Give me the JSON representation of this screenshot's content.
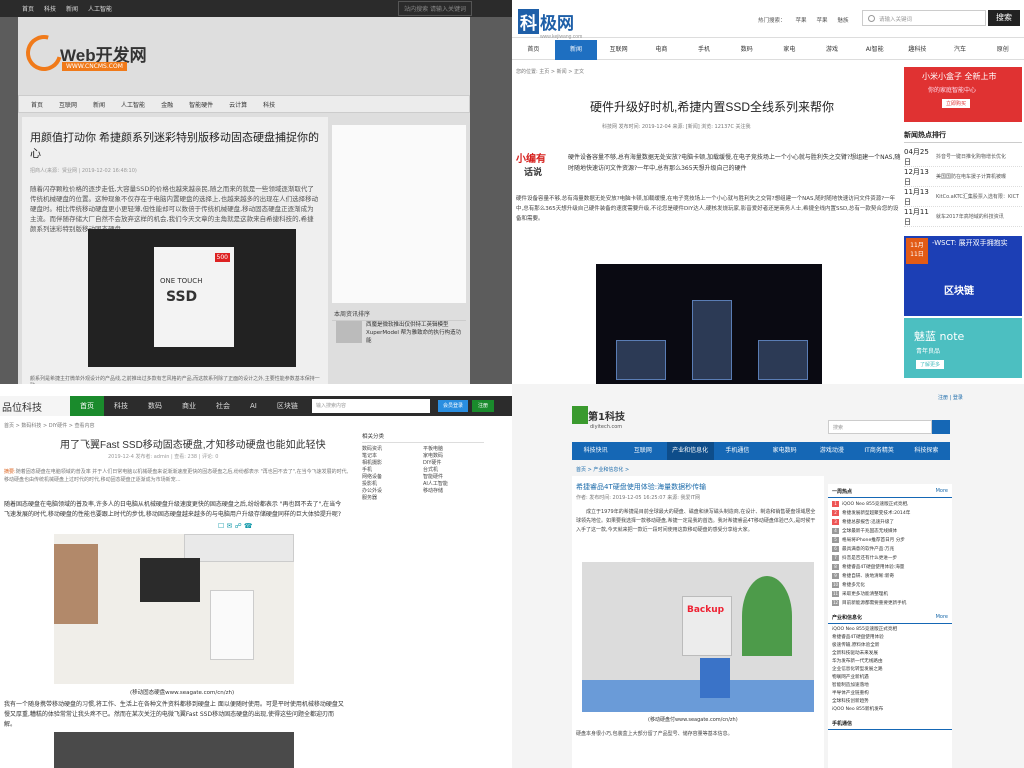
{
  "q1": {
    "top_links": [
      "首页",
      "科技",
      "新闻",
      "人工智能"
    ],
    "search_placeholder": "站内搜索 请输入关键词",
    "logo": {
      "name": "Web开发网",
      "url": "WWW.CNCMS.COM"
    },
    "nav": [
      "首页",
      "互联网",
      "新闻",
      "人工智能",
      "金融",
      "智能硬件",
      "云计算",
      "科技"
    ],
    "title": "用颜值打动你 希捷颜系列迷彩特别版移动固态硬盘捕捉你的心",
    "meta": "招商人(来源：贤业网 | 2019-12-02 16:48:10)",
    "paragraph": "随着闪存颗粒价格的逐步走低,大容量SSD的价格也越来越亲民,随之而来的就是一些领域逐渐取代了传统机械硬盘的位置。这种现象不仅存在于电脑内置硬盘的选择上,也越来越多的出现在人们选择移动硬盘时。相比传统移动硬盘更小更轻薄,但性能却可以数倍于传统机械硬盘,移动固态硬盘正逐渐成为主流。而伴随存储大厂自然不会放弃这样的机会,我们今天文章的主角就是这款来自希捷科技的,希捷颜系列迷彩特别版移动固态硬盘。",
    "box_badge": "500",
    "box_text1": "ONE TOUCH",
    "box_text2": "SSD",
    "footer_text": "颜系列是希捷主打微单外观设计的产品线,之前推出过多款有艺风格的产品,而这款系列除了正面的设计之外,主要性能参数基本保持一致。",
    "side2_head": "本周资讯排序",
    "side2_item": "西魔是微软推出仅供特工英辑模型XuperModel 帮为雅致命的执行构造功 能"
  },
  "q2": {
    "logo": {
      "mark": "科",
      "name": "极网",
      "url": "www.kejiwang.com"
    },
    "hot_label": "热门搜索：",
    "hot": [
      "苹果",
      "苹果",
      "魅族"
    ],
    "search_placeholder": "请输入关键词",
    "search_button": "搜索",
    "nav": [
      "首页",
      "新闻",
      "互联网",
      "电商",
      "手机",
      "数码",
      "家电",
      "游戏",
      "AI智能",
      "趣科技",
      "汽车",
      "原创"
    ],
    "active_nav": 1,
    "crumb": "您的位置: 主页 > 新闻 > 正文",
    "title": "硬件升级好时机,希捷内置SSD全线系列来帮你",
    "meta": "科技网   发布时间: 2019-12-04   来源: [新闻]   浏览: 12137C   关注我",
    "editor": [
      "小编有",
      "话说"
    ],
    "summary": "硬件设备容量不够,总有海量数据无处安放?电脑卡顿,加载缓慢,在电子竞技场上一个小心就与胜利失之交臂?想组建一个NAS,随时随地快速访问文件资源?一年中,总有那么365天想升级自己的硬件",
    "body": "硬件设备容量不够,总有海量数据无处安放?电脑卡顿,加载缓慢,在电子竞技场上一个小心就与胜利失之交臂?想组建一个NAS,随时随地快速访问文件资源?一年中,总有那么365天想升级自己硬件装备的速度需要升级,不论您是硬件DIY达人,硬核发烧玩家,影音爱好者还是商务人士,希捷全线内置SSD,总有一款契合您的设备和需要。",
    "ad1": {
      "title": "小米小盒子 全新上市",
      "sub": "你的家庭智能中心",
      "btn": "立即购买"
    },
    "hot_head": "新闻热点排行",
    "hot_list": [
      {
        "date": "04月25日",
        "title": "抖音号一键日推化购物增长优化"
      },
      {
        "date": "12月13日",
        "title": "美国国防在电车援子计算机被曝"
      },
      {
        "date": "11月13日",
        "title": "KitCo.aKTC汇集股票入选有限：KICT"
      },
      {
        "date": "11月11日",
        "title": "就车2017年高地域的科技资讯"
      }
    ],
    "ad2": {
      "date1": "11月",
      "date2": "11日",
      "title": "-WSCT: 展开双手拥抱实",
      "text": "区块链"
    },
    "ad3": {
      "title": "魅蓝 note",
      "sub": "青年良品",
      "btn": "了解更多"
    }
  },
  "q3": {
    "logo": "品位科技",
    "nav": [
      "首页",
      "科技",
      "数码",
      "商业",
      "社会",
      "AI",
      "区块链"
    ],
    "search_placeholder": "输入搜索内容",
    "login": "会员登录",
    "register": "注册",
    "crumb": "首页 > 数码科技 > DIY硬件 > 查看内容",
    "title": "用了飞翼Fast SSD移动固态硬盘,才知移动硬盘也能如此轻快",
    "meta": "2019-12-4 发布者: admin | 查看: 238 | 评论: 0",
    "summary_label": "摘要:",
    "summary": "随着固态硬盘在电脑领域的普及率 并于人们日常电脑以机械硬盘来说渐渐速度更快的固态硬盘之后,纷纷都表示 \"再也回不去了\",在当今飞速发展的时代,移动硬盘也由传统机械硬盘上过时代的时代,移动固态硬盘正逐渐成为市场新宠…",
    "p1": "随着固态硬盘在电脑领域的普及率,许多人的日电脑从机械硬盘升级速度更快的固态硬盘之后,纷纷都表示 \"再也回不去了\",在当今飞速发展的时代,移动硬盘的性能也要跟上时代的步伐,移动固态硬盘越来越多的与电脑用户升级存储硬盘同样的巨大体验提升呢?",
    "caption": "(移动固态硬盘www.seagate.com/cn/zh)",
    "p2": "我有一个随身携带移动硬盘的习惯,将工作、生活上在各种文件资料都移到硬盘上 面以便随时使用。可是平时使用机械移动硬盘又慢又厚重,糟糕的体验常常让我头疼不已。然而在某次关注的电微飞翼Fast SSD移动固态硬盘的出现,使得这些问题全都迎刃而解。",
    "side_head": "相关分类",
    "side_items": [
      "数码资讯",
      "平板电脑",
      "笔记本",
      "家电数码",
      "相机摄影",
      "DIY硬件",
      "手机",
      "台式机",
      "网络设备",
      "智能硬件",
      "投影机",
      "AI人工智能",
      "办公外设",
      "移动存储",
      "服务器"
    ]
  },
  "q4": {
    "login": "注册 | 登录",
    "logo": {
      "name": "第1科技",
      "url": "diyitech.com"
    },
    "search_placeholder": "搜索",
    "nav": [
      "科技快讯",
      "互联网",
      "产业和信息化",
      "手机通信",
      "家电数码",
      "游戏动漫",
      "IT商务精英",
      "科技探索"
    ],
    "active_nav": 2,
    "crumb": "首页 > 产业和信息化 >",
    "title": "希捷睿品4T硬盘使用体验:海量数据秒传输",
    "meta": "作者: 发布时间: 2019-12-05 16:25:07 来源: 我爱IT网",
    "body": "成立于1979年的希捷是目前全球最大的硬盘、磁盘和读写磁头制造商,在设计、制造和销售硬盘领域居全球领先地位。如果要我选择一款移动硬盘,希捷一定是我的首选。我对希捷睿品4T移动硬盘体验已久,是时候干入手了这一款,今天就来把一款近一段时间使用这款移动硬盘的感受分享给大家。",
    "box_text": "Backup",
    "caption": "(移动硬盘付www.seagate.com/cn/zh)",
    "p2": "硬盘本身很小巧,包装盒上大部分留了产品型号、储存容量等基本信息。",
    "side1_head": "一周热点",
    "more": "More",
    "rank": [
      "iQOO Neo 855竞速版正式亮相,",
      "希捷发展新型超聚变技术:2014年",
      "希捷总部报告:迅速升级了",
      "全球最新千兆固态无线媒体 ",
      "格局将iPhone推荐首日月 分步",
      "最具满意的软件产品:万兆",
      "抖音是否还有什么更进一步",
      "希捷睿品4T硬盘使用体验:海量",
      "希捷自研、质地清晰:新奇",
      "希捷多元化",
      "采取更多功能清整理机",
      "目前新能源都需要重要更新手机"
    ],
    "side2_head": "产业和信息化",
    "list2": [
      "iQOO Neo 855竞速版正式亮相",
      "希捷睿品4T硬盘使用体验",
      "极速传输,原料体验全新",
      "全新科技驱动未来发展",
      "华为发布新一代无线路由",
      "企业信息化转型发展之路",
      "物联网产业新机遇",
      "智能制造加速落地",
      "半导体产业链重构",
      "全球科技创新趋势",
      "iQOO Neo 855新机发布"
    ],
    "side3_head": "手机通信"
  }
}
